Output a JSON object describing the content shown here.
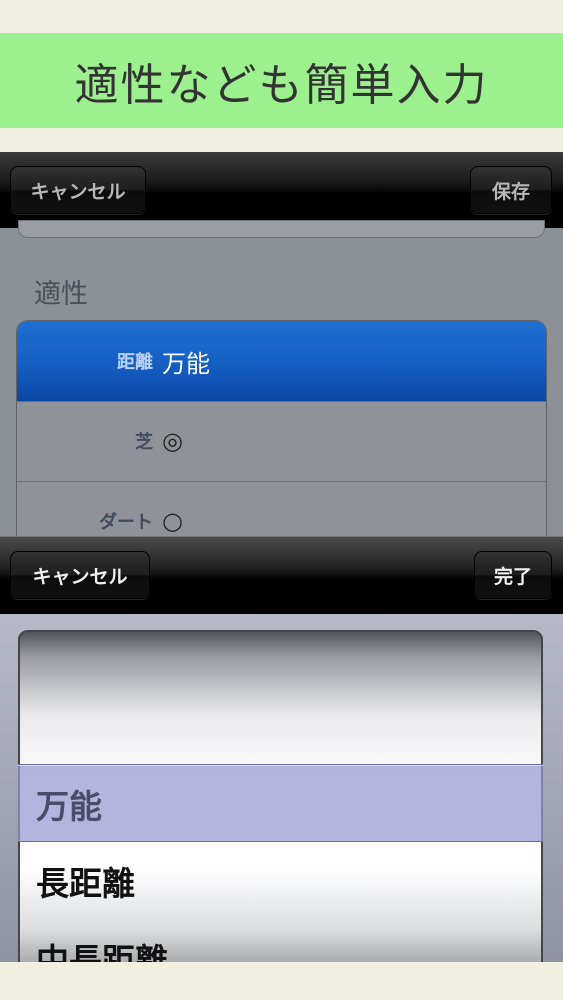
{
  "banner": {
    "text": "適性なども簡単入力"
  },
  "top_nav": {
    "cancel_label": "キャンセル",
    "save_label": "保存"
  },
  "form": {
    "section_title": "適性",
    "rows": [
      {
        "label": "距離",
        "value": "万能"
      },
      {
        "label": "芝",
        "value": "◎"
      },
      {
        "label": "ダート",
        "value": "○"
      }
    ]
  },
  "picker_toolbar": {
    "cancel_label": "キャンセル",
    "done_label": "完了"
  },
  "picker": {
    "items": [
      "万能",
      "長距離",
      "中長距離"
    ],
    "selected": "万能"
  }
}
